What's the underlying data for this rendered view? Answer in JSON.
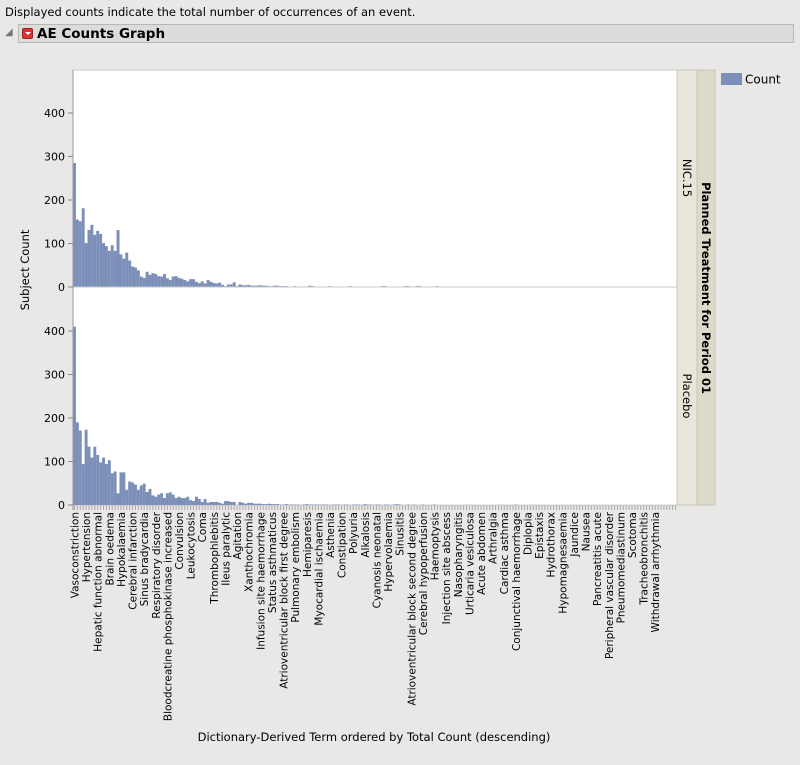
{
  "header": {
    "note": "Displayed counts indicate the total number of occurrences of an event.",
    "title": "AE Counts Graph"
  },
  "chart_data": {
    "type": "bar",
    "title": "",
    "xlabel": "Dictionary-Derived Term ordered by Total Count (descending)",
    "ylabel": "Subject Count",
    "ylim": [
      0,
      480
    ],
    "yticks": [
      0,
      100,
      200,
      300,
      400
    ],
    "group_label": "Planned Treatment for Period 01",
    "legend": {
      "entries": [
        "Count"
      ],
      "position": "right",
      "color": "#7b8fb8"
    },
    "bar_color": "#7b8fb8",
    "category_labels": [
      "Vasoconstriction",
      "Hypertension",
      "Hepatic function abnormal",
      "Brain oedema",
      "Hypokalaemia",
      "Cerebral infarction",
      "Sinus bradycardia",
      "Respiratory disorder",
      "Bloodcreatine phosphokinase increased",
      "Convulsion",
      "Leukocytosis",
      "Coma",
      "Thrombophlebitis",
      "Ileus paralytic",
      "Agitation",
      "Xanthochromia",
      "Infusion site haemorrhage",
      "Status asthmaticus",
      "Atrioventricular block first degree",
      "Pulmonary embolism",
      "Hemiparesis",
      "Myocardial ischaemia",
      "Asthenia",
      "Constipation",
      "Polyuria",
      "Alkalosis",
      "Cyanosis neonatal",
      "Hypervolaemia",
      "Sinusitis",
      "Atrioventricular block second degree",
      "Cerebral hypoperfusion",
      "Haemoptysis",
      "Injection site abscess",
      "Nasopharyngitis",
      "Urticaria vesiculosa",
      "Acute abdomen",
      "Arthralgia",
      "Cardiac asthma",
      "Conjunctival haemorrhage",
      "Diplopia",
      "Epistaxis",
      "Hydrothorax",
      "Hypomagnesaemia",
      "Jaundice",
      "Nausea",
      "Pancreatitis acute",
      "Peripheral vascular disorder",
      "Pneumomediastinum",
      "Scotoma",
      "Tracheobronchitis",
      "Withdrawal arrhythmia"
    ],
    "series": [
      {
        "name": "NIC.15",
        "values": [
          285,
          155,
          151,
          181,
          101,
          131,
          143,
          120,
          129,
          122,
          101,
          94,
          83,
          96,
          83,
          131,
          75,
          65,
          79,
          61,
          47,
          45,
          38,
          24,
          21,
          35,
          28,
          32,
          30,
          25,
          24,
          30,
          20,
          16,
          24,
          25,
          21,
          19,
          16,
          13,
          18,
          18,
          12,
          9,
          13,
          8,
          16,
          12,
          9,
          8,
          10,
          5,
          2,
          6,
          6,
          11,
          2,
          6,
          4,
          4,
          5,
          3,
          3,
          3,
          4,
          3,
          3,
          2,
          2,
          3,
          3,
          2,
          2,
          2,
          1,
          1,
          2,
          1,
          1,
          0,
          1,
          3,
          2,
          1,
          1,
          0,
          1,
          1,
          2,
          1,
          0,
          1,
          1,
          0,
          1,
          2,
          1,
          1,
          0,
          1,
          1,
          1,
          0,
          1,
          1,
          1,
          2,
          2,
          1,
          1,
          1,
          1,
          1,
          1,
          2,
          2,
          1,
          1,
          2,
          2,
          1,
          1,
          1,
          1,
          1,
          2,
          1,
          1,
          0,
          1,
          0,
          1,
          0,
          1,
          1,
          0,
          1,
          1,
          0,
          1,
          1,
          0,
          1,
          0,
          0,
          1,
          1,
          0,
          1,
          0,
          0,
          1,
          0,
          0,
          1,
          1,
          0,
          1,
          0,
          0,
          0,
          1,
          1,
          0,
          1,
          0,
          0,
          0,
          0,
          1,
          1,
          0,
          0,
          1,
          0,
          0,
          1,
          1,
          0,
          1,
          1,
          1,
          1,
          0,
          0,
          1,
          0,
          0,
          1,
          1,
          0,
          1,
          0,
          0,
          1,
          1,
          1,
          0,
          0,
          1,
          1,
          0,
          1,
          1,
          1,
          0
        ]
      },
      {
        "name": "Placebo",
        "values": [
          410,
          190,
          171,
          94,
          173,
          134,
          109,
          134,
          115,
          98,
          109,
          94,
          103,
          73,
          77,
          27,
          75,
          75,
          35,
          54,
          52,
          47,
          35,
          45,
          49,
          30,
          37,
          22,
          19,
          24,
          27,
          16,
          27,
          29,
          24,
          16,
          19,
          16,
          16,
          19,
          11,
          9,
          19,
          14,
          7,
          14,
          5,
          7,
          7,
          7,
          5,
          3,
          9,
          9,
          7,
          7,
          0,
          7,
          5,
          3,
          5,
          5,
          3,
          3,
          3,
          2,
          2,
          3,
          2,
          2,
          2,
          1,
          1,
          2,
          1,
          1,
          1,
          1,
          0,
          1,
          2,
          1,
          1,
          1,
          1,
          1,
          1,
          1,
          0,
          1,
          1,
          1,
          0,
          1,
          1,
          0,
          1,
          1,
          1,
          0,
          2,
          1,
          1,
          0,
          1,
          1,
          0,
          1,
          1,
          0,
          1,
          2,
          1,
          0,
          0,
          1,
          0,
          1,
          0,
          0,
          1,
          0,
          0,
          0,
          1,
          0,
          0,
          0,
          0,
          0,
          0,
          0,
          0,
          0,
          0,
          0,
          0,
          0,
          0,
          0,
          0,
          0,
          0,
          0,
          0,
          0,
          0,
          0,
          0,
          0,
          0,
          0,
          1,
          0,
          0,
          0,
          0,
          0,
          0,
          0,
          0,
          0,
          0,
          0,
          0,
          0,
          0,
          0,
          0,
          0,
          0,
          0,
          0,
          0,
          0,
          0,
          0,
          0,
          0,
          0,
          0,
          0,
          0,
          0,
          0,
          0,
          0,
          0,
          0,
          0,
          0,
          0,
          0,
          0,
          0,
          0,
          0,
          0,
          0,
          0,
          0,
          0,
          0,
          0,
          0,
          0,
          0,
          0
        ]
      }
    ]
  }
}
